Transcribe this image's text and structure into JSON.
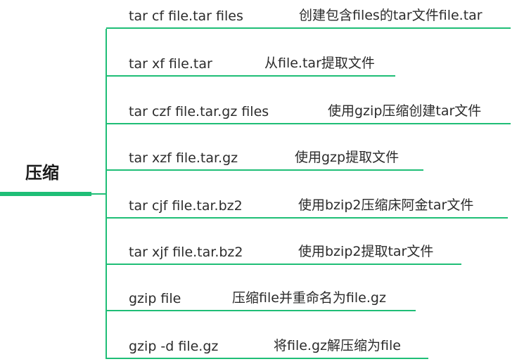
{
  "root": {
    "label": "压缩"
  },
  "branches": [
    {
      "cmd": "tar cf file.tar files",
      "desc": "创建包含files的tar文件file.tar"
    },
    {
      "cmd": "tar xf file.tar",
      "desc": "从file.tar提取文件"
    },
    {
      "cmd": "tar czf file.tar.gz files",
      "desc": "使用gzip压缩创建tar文件"
    },
    {
      "cmd": "tar xzf file.tar.gz",
      "desc": "使用gzp提取文件"
    },
    {
      "cmd": "tar cjf file.tar.bz2",
      "desc": "使用bzip2压缩床阿金tar文件"
    },
    {
      "cmd": "tar xjf file.tar.bz2",
      "desc": "使用bzip2提取tar文件"
    },
    {
      "cmd": "gzip file",
      "desc": "压缩file并重命名为file.gz"
    },
    {
      "cmd": "gzip -d file.gz",
      "desc": "将file.gz解压缩为file"
    }
  ],
  "colors": {
    "accent": "#1fbe76",
    "text": "#2b2b2b"
  }
}
